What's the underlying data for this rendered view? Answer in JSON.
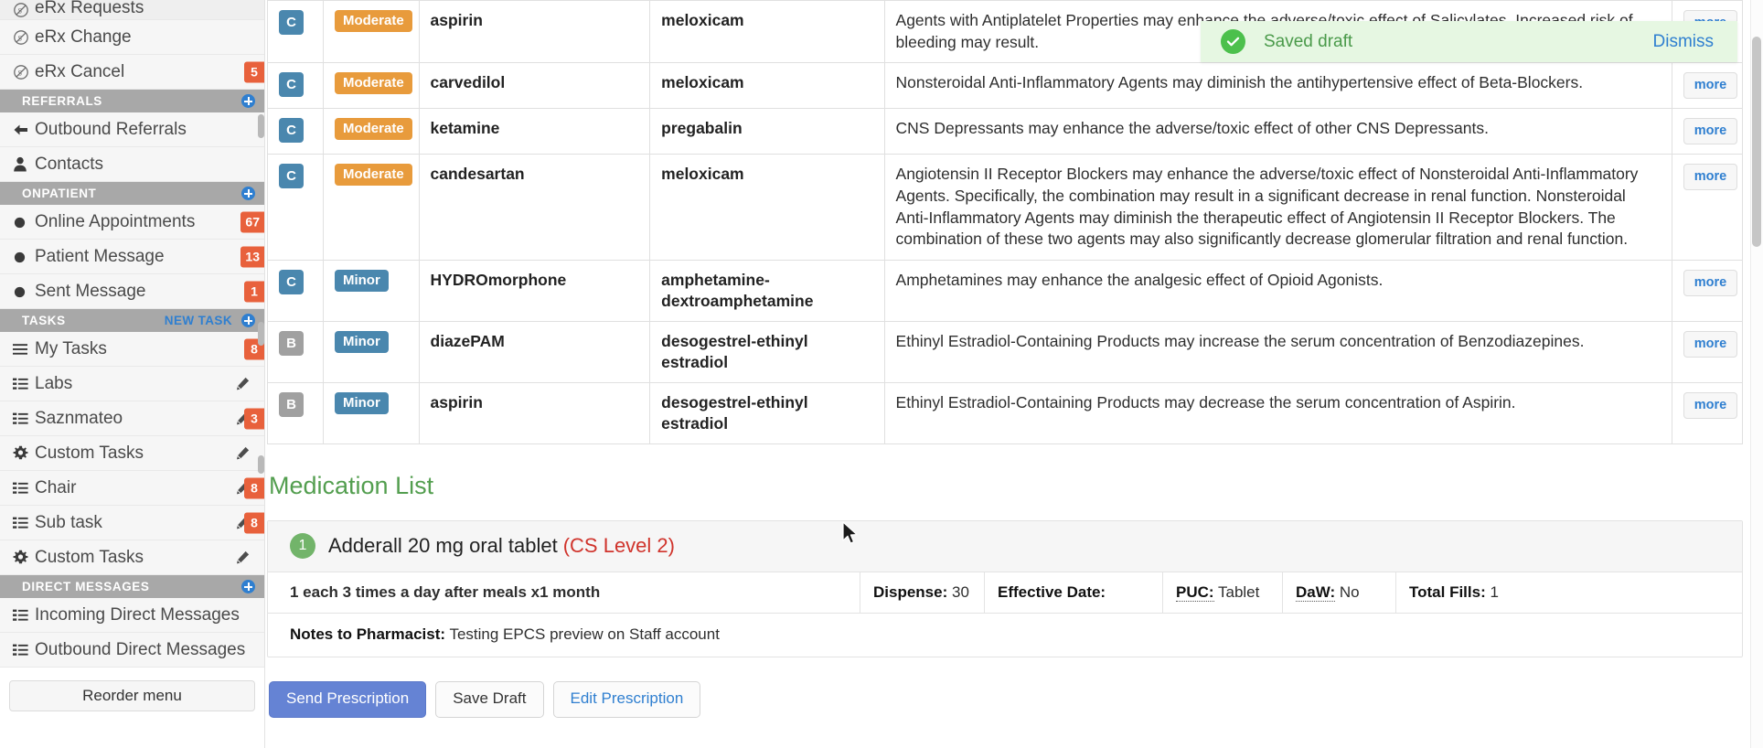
{
  "sidebar": {
    "items": [
      {
        "label": "eRx Requests",
        "icon": "erx-icon",
        "badge": null,
        "pencil": false,
        "partial": true
      },
      {
        "label": "eRx Change",
        "icon": "erx-icon",
        "badge": null,
        "pencil": false
      },
      {
        "label": "eRx Cancel",
        "icon": "erx-icon",
        "badge": "5",
        "pencil": false
      }
    ],
    "sections": [
      {
        "title": "REFERRALS",
        "action": null,
        "items": [
          {
            "label": "Outbound Referrals",
            "icon": "arrow-left-icon",
            "badge": null,
            "pencil": false
          },
          {
            "label": "Contacts",
            "icon": "person-icon",
            "badge": null,
            "pencil": false
          }
        ]
      },
      {
        "title": "ONPATIENT",
        "action": null,
        "items": [
          {
            "label": "Online Appointments",
            "icon": "dot-icon",
            "badge": "67",
            "pencil": false
          },
          {
            "label": "Patient Message",
            "icon": "dot-icon",
            "badge": "13",
            "pencil": false
          },
          {
            "label": "Sent Message",
            "icon": "dot-icon",
            "badge": "1",
            "pencil": false
          }
        ]
      },
      {
        "title": "TASKS",
        "action": "NEW TASK",
        "items": [
          {
            "label": "My Tasks",
            "icon": "hamburger-icon",
            "badge": "8",
            "pencil": false
          },
          {
            "label": "Labs",
            "icon": "list-icon",
            "badge": null,
            "pencil": true
          },
          {
            "label": "Saznmateo",
            "icon": "list-icon",
            "badge": "3",
            "pencil": true
          },
          {
            "label": "Custom Tasks",
            "icon": "gear-icon",
            "badge": null,
            "pencil": true
          },
          {
            "label": "Chair",
            "icon": "list-icon",
            "badge": "8",
            "pencil": true
          },
          {
            "label": "Sub task",
            "icon": "list-icon",
            "badge": "8",
            "pencil": true
          },
          {
            "label": "Custom Tasks",
            "icon": "gear-icon",
            "badge": null,
            "pencil": true
          }
        ]
      },
      {
        "title": "DIRECT MESSAGES",
        "action": null,
        "items": [
          {
            "label": "Incoming Direct Messages",
            "icon": "list-icon",
            "badge": null,
            "pencil": false
          },
          {
            "label": "Outbound Direct Messages",
            "icon": "list-icon",
            "badge": null,
            "pencil": false
          }
        ]
      }
    ],
    "reorder_label": "Reorder menu"
  },
  "toast": {
    "message": "Saved draft",
    "dismiss_label": "Dismiss",
    "icon": "check-circle-icon",
    "bg_color": "#e6f7e2",
    "text_color": "#4a9a4a",
    "accent_color": "#4cc04c"
  },
  "interactions": {
    "more_label": "more",
    "rows": [
      {
        "severity": "C",
        "level": "Moderate",
        "drug1": "aspirin",
        "drug2": "meloxicam",
        "description": "Agents with Antiplatelet Properties may enhance the adverse/toxic effect of Salicylates. Increased risk of bleeding may result."
      },
      {
        "severity": "C",
        "level": "Moderate",
        "drug1": "carvedilol",
        "drug2": "meloxicam",
        "description": "Nonsteroidal Anti-Inflammatory Agents may diminish the antihypertensive effect of Beta-Blockers."
      },
      {
        "severity": "C",
        "level": "Moderate",
        "drug1": "ketamine",
        "drug2": "pregabalin",
        "description": "CNS Depressants may enhance the adverse/toxic effect of other CNS Depressants."
      },
      {
        "severity": "C",
        "level": "Moderate",
        "drug1": "candesartan",
        "drug2": "meloxicam",
        "description": "Angiotensin II Receptor Blockers may enhance the adverse/toxic effect of Nonsteroidal Anti-Inflammatory Agents. Specifically, the combination may result in a significant decrease in renal function. Nonsteroidal Anti-Inflammatory Agents may diminish the therapeutic effect of Angiotensin II Receptor Blockers. The combination of these two agents may also significantly decrease glomerular filtration and renal function."
      },
      {
        "severity": "C",
        "level": "Minor",
        "drug1": "HYDROmorphone",
        "drug2": "amphetamine-dextroamphetamine",
        "description": "Amphetamines may enhance the analgesic effect of Opioid Agonists."
      },
      {
        "severity": "B",
        "level": "Minor",
        "drug1": "diazePAM",
        "drug2": "desogestrel-ethinyl estradiol",
        "description": "Ethinyl Estradiol-Containing Products may increase the serum concentration of Benzodiazepines."
      },
      {
        "severity": "B",
        "level": "Minor",
        "drug1": "aspirin",
        "drug2": "desogestrel-ethinyl estradiol",
        "description": "Ethinyl Estradiol-Containing Products may decrease the serum concentration of Aspirin."
      }
    ]
  },
  "medication_list": {
    "title": "Medication List",
    "medications": [
      {
        "number": "1",
        "name": "Adderall 20 mg oral tablet",
        "cs_level": "(CS Level 2)",
        "sig": "1 each 3 times a day after meals x1 month",
        "dispense_label": "Dispense:",
        "dispense_value": "30",
        "effective_date_label": "Effective Date:",
        "effective_date_value": "",
        "puc_label": "PUC:",
        "puc_value": "Tablet",
        "daw_label": "DaW:",
        "daw_value": "No",
        "total_fills_label": "Total Fills:",
        "total_fills_value": "1",
        "notes_label": "Notes to Pharmacist:",
        "notes_value": "Testing EPCS preview on Staff account"
      }
    ]
  },
  "actions": {
    "send_label": "Send Prescription",
    "save_draft_label": "Save Draft",
    "edit_label": "Edit Prescription"
  }
}
